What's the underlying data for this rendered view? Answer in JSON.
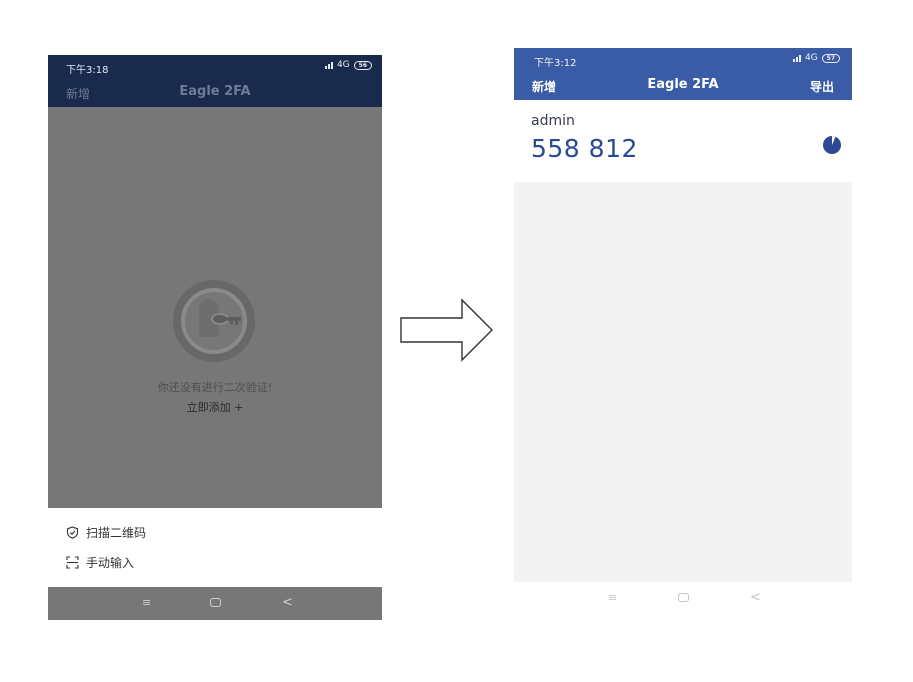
{
  "left_screen": {
    "status": {
      "time": "下午3:18",
      "network": "4G",
      "battery": "56"
    },
    "header": {
      "add_label": "新增",
      "title": "Eagle 2FA"
    },
    "empty_state": {
      "message": "你还没有进行二次验证!",
      "add_now_label": "立即添加 +",
      "icon": "key-lock-icon"
    },
    "sheet": {
      "items": [
        {
          "label": "扫描二维码",
          "icon": "shield-check-icon"
        },
        {
          "label": "手动输入",
          "icon": "scan-frame-icon"
        }
      ]
    },
    "nav": {
      "menu_glyph": "≡",
      "back_glyph": "<"
    }
  },
  "right_screen": {
    "status": {
      "time": "下午3:12",
      "network": "4G",
      "battery": "57"
    },
    "header": {
      "add_label": "新增",
      "title": "Eagle 2FA",
      "export_label": "导出"
    },
    "accounts": [
      {
        "name": "admin",
        "code": "558 812",
        "timer_icon": "countdown-pie-icon"
      }
    ],
    "nav": {
      "menu_glyph": "≡",
      "back_glyph": "<"
    }
  },
  "colors": {
    "left_header_bg": "#1a2a4c",
    "overlay_gray": "#777777",
    "right_header_bg": "#3a5ba5",
    "code_blue": "#2c4a93"
  },
  "transition_icon": "right-arrow-icon"
}
